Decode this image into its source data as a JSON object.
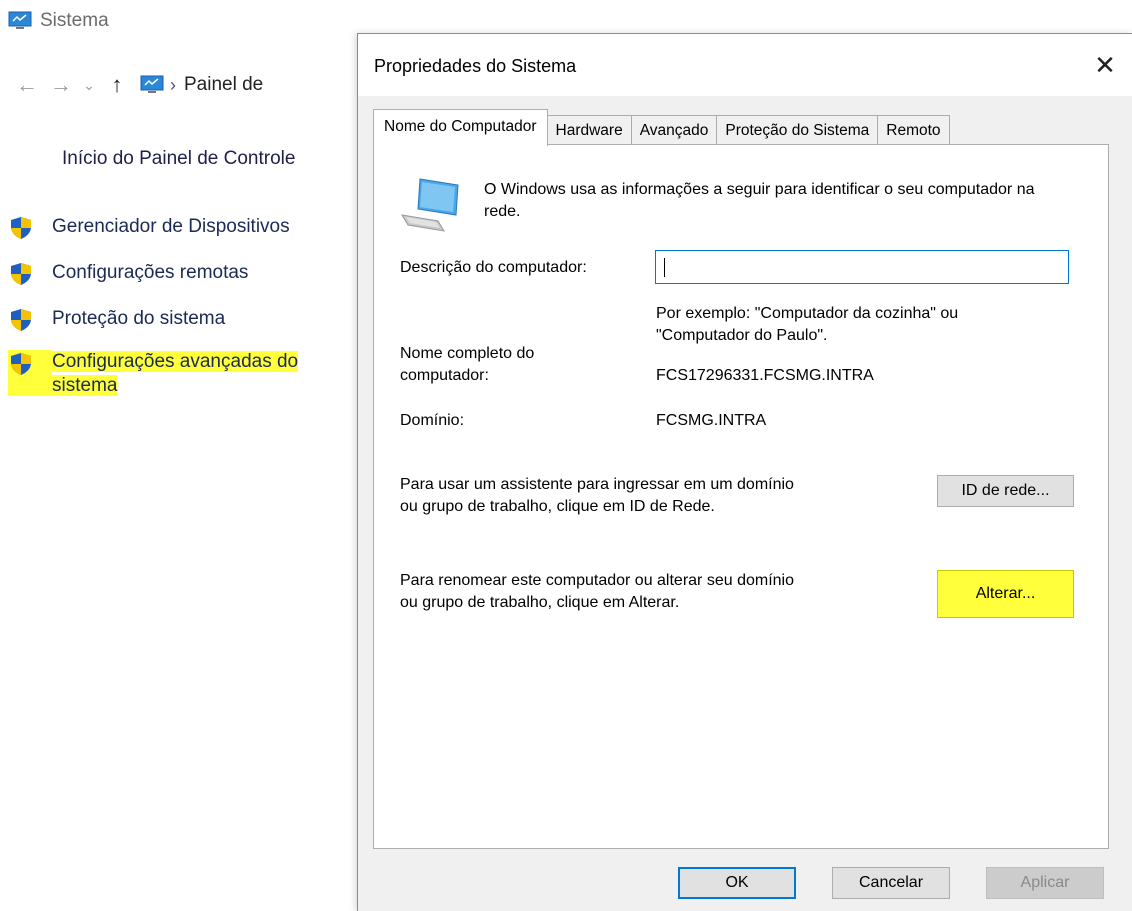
{
  "control_panel": {
    "window_title": "Sistema",
    "breadcrumb": "Painel de",
    "home_link": "Início do Painel de Controle",
    "links": [
      {
        "label": "Gerenciador de Dispositivos",
        "icon": "shield-icon"
      },
      {
        "label": "Configurações remotas",
        "icon": "shield-icon"
      },
      {
        "label": "Proteção do sistema",
        "icon": "shield-icon"
      },
      {
        "label_line1": "Configurações avançadas do",
        "label_line2": "sistema",
        "icon": "shield-icon",
        "highlighted": true
      }
    ],
    "highlight_color": "#ffff3c"
  },
  "dialog": {
    "title": "Propriedades do Sistema",
    "close_icon": "close-icon",
    "tabs": [
      {
        "label": "Nome do Computador",
        "active": true
      },
      {
        "label": "Hardware",
        "active": false
      },
      {
        "label": "Avançado",
        "active": false
      },
      {
        "label": "Proteção do Sistema",
        "active": false
      },
      {
        "label": "Remoto",
        "active": false
      }
    ],
    "intro_text": "O Windows usa as informações a seguir para identificar o seu computador na rede.",
    "description_label": "Descrição do computador:",
    "description_value": "",
    "example_text_line1": "Por exemplo: \"Computador da cozinha\" ou",
    "example_text_line2": "\"Computador do Paulo\".",
    "full_name_label_line1": "Nome completo do",
    "full_name_label_line2": "computador:",
    "full_name_value": "FCS17296331.FCSMG.INTRA",
    "domain_label": "Domínio:",
    "domain_value": "FCSMG.INTRA",
    "network_id_text_line1": "Para usar um assistente para ingressar em um domínio",
    "network_id_text_line2": "ou grupo de trabalho, clique em ID de Rede.",
    "network_id_button": "ID de rede...",
    "rename_text_line1": "Para renomear este computador ou alterar seu domínio",
    "rename_text_line2": "ou grupo de trabalho, clique em Alterar.",
    "change_button": "Alterar...",
    "ok_button": "OK",
    "cancel_button": "Cancelar",
    "apply_button": "Aplicar",
    "accent_color": "#0078d7"
  }
}
